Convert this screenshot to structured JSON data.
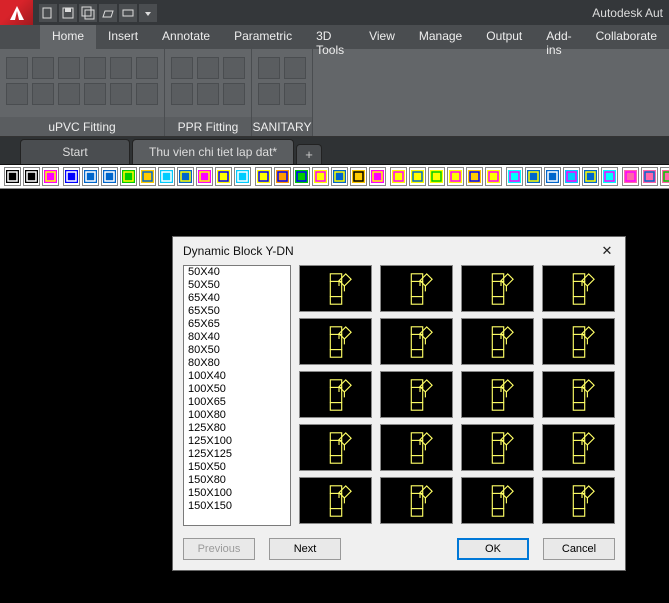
{
  "titlebar": {
    "app_title": "Autodesk Aut"
  },
  "ribbon": {
    "tabs": [
      "Home",
      "Insert",
      "Annotate",
      "Parametric",
      "3D Tools",
      "View",
      "Manage",
      "Output",
      "Add-ins",
      "Collaborate"
    ],
    "activeTab": 0,
    "panels": [
      {
        "label": "uPVC Fitting",
        "rows": [
          6,
          6
        ]
      },
      {
        "label": "PPR Fitting",
        "rows": [
          3,
          3
        ]
      },
      {
        "label": "SANITARY",
        "rows": [
          2,
          2
        ]
      }
    ]
  },
  "doc_tabs": {
    "tabs": [
      {
        "label": "Start",
        "active": false
      },
      {
        "label": "Thu vien chi tiet lap dat*",
        "active": true
      }
    ],
    "add_glyph": "+"
  },
  "iconbar_groups": [
    3,
    10,
    7,
    6,
    6,
    5
  ],
  "dialog": {
    "title": "Dynamic Block Y-DN",
    "close_glyph": "✕",
    "list": [
      "50X40",
      "50X50",
      "65X40",
      "65X50",
      "65X65",
      "80X40",
      "80X50",
      "80X80",
      "100X40",
      "100X50",
      "100X65",
      "100X80",
      "125X80",
      "125X100",
      "125X125",
      "150X50",
      "150X80",
      "150X100",
      "150X150"
    ],
    "thumb_count": 20,
    "buttons": {
      "previous": "Previous",
      "next": "Next",
      "ok": "OK",
      "cancel": "Cancel"
    }
  }
}
